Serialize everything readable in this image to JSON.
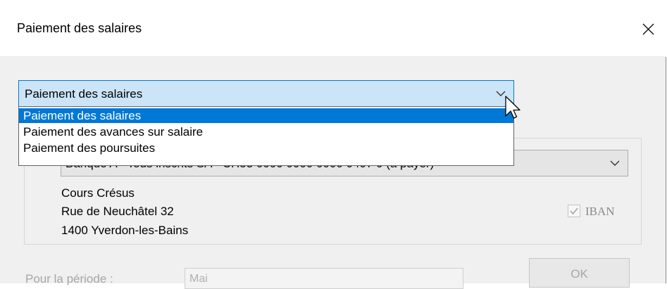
{
  "window": {
    "title": "Paiement des salaires"
  },
  "payment_type": {
    "selected": "Paiement des salaires",
    "options": [
      "Paiement des salaires",
      "Paiement des avances sur salaire",
      "Paiement des poursuites"
    ],
    "highlighted_index": 0
  },
  "bank_account": {
    "value": "Banque A - Tous inscrits SA - CH53 0000 0000 0000 0407 0 (à payer)"
  },
  "address": {
    "line1": "Cours Crésus",
    "line2": "Rue de Neuchâtel 32",
    "line3": "1400 Yverdon-les-Bains"
  },
  "iban": {
    "label": "IBAN",
    "checked": true
  },
  "period": {
    "label": "Pour la période :",
    "value": "Mai"
  },
  "ok_button": {
    "label": "OK"
  },
  "colors": {
    "accent": "#0078d7",
    "combo_active_bg": "#cce4f7"
  }
}
